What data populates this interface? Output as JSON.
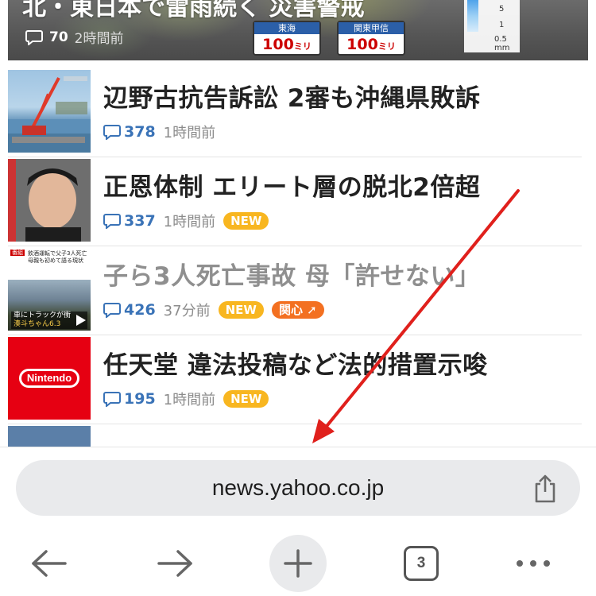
{
  "hero": {
    "title": "北・東日本で雷雨続く 災害警戒",
    "comment_count": "70",
    "time": "2時間前",
    "rain_boxes": [
      {
        "label": "東海",
        "value": "100",
        "unit": "ミリ"
      },
      {
        "label": "関東甲信",
        "value": "100",
        "unit": "ミリ"
      }
    ],
    "legend": {
      "v5": "5",
      "v1": "1",
      "v05": "0.5",
      "unit": "mm"
    }
  },
  "articles": [
    {
      "title": "辺野古抗告訴訟 2審も沖縄県敗訴",
      "comments": "378",
      "time": "1時間前",
      "badges": [],
      "read": false
    },
    {
      "title": "正恩体制 エリート層の脱北2倍超",
      "comments": "337",
      "time": "1時間前",
      "badges": [
        "NEW"
      ],
      "read": false
    },
    {
      "title": "子ら3人死亡事故 母「許せない」",
      "comments": "426",
      "time": "37分前",
      "badges": [
        "NEW",
        "関心"
      ],
      "read": true
    },
    {
      "title": "任天堂 違法投稿など法的措置示唆",
      "comments": "195",
      "time": "1時間前",
      "badges": [
        "NEW"
      ],
      "read": false
    }
  ],
  "thumb3": {
    "tag": "番組",
    "headline1": "飲酒運転で父子3人死亡",
    "headline2": "母親も初めて語る現状",
    "caption1": "車にトラックが衝",
    "caption2": "湊斗ちゃん6.3"
  },
  "thumb4": {
    "brand": "Nintendo"
  },
  "browser": {
    "url": "news.yahoo.co.jp",
    "tab_count": "3"
  },
  "colors": {
    "accent_comment": "#3a73b7",
    "badge_new": "#f8b620",
    "badge_hot": "#f37021",
    "annotation_arrow": "#e0201c"
  },
  "icons": [
    "back-arrow-icon",
    "forward-arrow-icon",
    "plus-icon",
    "tabs-icon",
    "more-icon",
    "share-icon",
    "comment-icon"
  ]
}
